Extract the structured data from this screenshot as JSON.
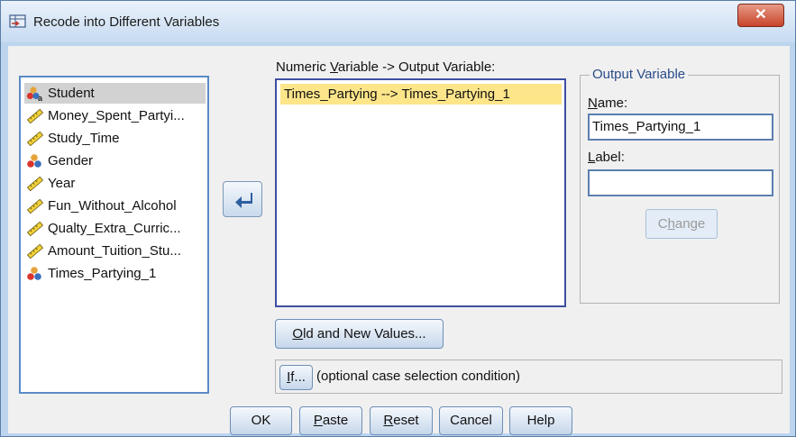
{
  "window": {
    "title": "Recode into Different Variables",
    "close_label": "✕"
  },
  "variables": [
    {
      "label": "Student",
      "icon": "nominal-string-icon",
      "selected": true
    },
    {
      "label": "Money_Spent_Partyi...",
      "icon": "scale-ruler-icon"
    },
    {
      "label": "Study_Time",
      "icon": "scale-ruler-icon"
    },
    {
      "label": "Gender",
      "icon": "nominal-icon"
    },
    {
      "label": "Year",
      "icon": "scale-ruler-icon"
    },
    {
      "label": "Fun_Without_Alcohol",
      "icon": "scale-ruler-icon"
    },
    {
      "label": "Qualty_Extra_Curric...",
      "icon": "scale-ruler-icon"
    },
    {
      "label": "Amount_Tuition_Stu...",
      "icon": "scale-ruler-icon"
    },
    {
      "label": "Times_Partying_1",
      "icon": "nominal-icon"
    }
  ],
  "mapping": {
    "header_pre": "Numeric ",
    "header_key": "V",
    "header_post": "ariable -> Output Variable:",
    "items": [
      "Times_Partying --> Times_Partying_1"
    ]
  },
  "output_variable": {
    "legend": "Output Variable",
    "name_key": "N",
    "name_rest": "ame:",
    "name_value": "Times_Partying_1",
    "label_key": "L",
    "label_rest": "abel:",
    "label_value": "",
    "change_pre": "C",
    "change_key": "h",
    "change_post": "ange"
  },
  "buttons": {
    "old_new_key": "O",
    "old_new_rest": "ld and New Values...",
    "if_key": "I",
    "if_rest": "f...",
    "if_description": "(optional case selection condition)",
    "ok": "OK",
    "paste_key": "P",
    "paste_rest": "aste",
    "reset_key": "R",
    "reset_rest": "eset",
    "cancel": "Cancel",
    "help": "Help"
  },
  "colors": {
    "accent": "#3f4fa0",
    "selection_highlight": "#fde58a",
    "list_selection": "#d2d2d2"
  }
}
